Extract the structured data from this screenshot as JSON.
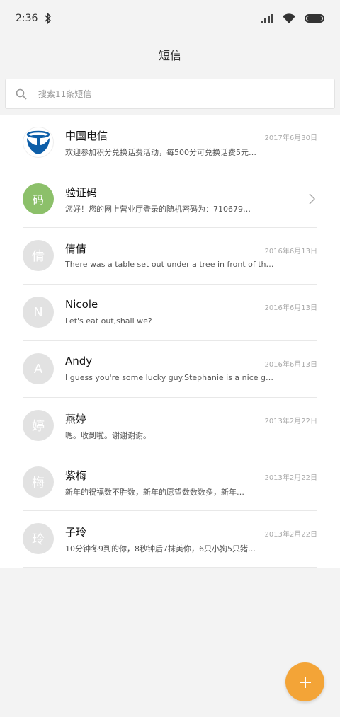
{
  "status_bar": {
    "time": "2:36",
    "icons": [
      "bluetooth-icon",
      "signal-icon",
      "wifi-icon",
      "battery-icon"
    ]
  },
  "header": {
    "title": "短信"
  },
  "search": {
    "placeholder": "搜索11条短信",
    "value": ""
  },
  "conversations": [
    {
      "name": "中国电信",
      "preview": "欢迎参加积分兑换话费活动，每500分可兑换话费5元…",
      "date": "2017年6月30日",
      "avatar_text": "",
      "avatar": "china-telecom-logo"
    },
    {
      "name": "验证码",
      "preview": "您好！您的网上营业厅登录的随机密码为：710679…",
      "date": "",
      "avatar_text": "码",
      "avatar": "green-code-avatar"
    },
    {
      "name": "倩倩",
      "preview": "There was a table set out under a tree in front of th…",
      "date": "2016年6月13日",
      "avatar_text": "倩",
      "avatar": "grey-avatar"
    },
    {
      "name": "Nicole",
      "preview": "Let's eat out,shall we?",
      "date": "2016年6月13日",
      "avatar_text": "N",
      "avatar": "grey-avatar"
    },
    {
      "name": "Andy",
      "preview": "I guess you're some lucky guy.Stephanie is a nice girl.",
      "date": "2016年6月13日",
      "avatar_text": "A",
      "avatar": "grey-avatar"
    },
    {
      "name": "燕婷",
      "preview": "嗯。收到啦。谢谢谢谢。",
      "date": "2013年2月22日",
      "avatar_text": "婷",
      "avatar": "grey-avatar"
    },
    {
      "name": "紫梅",
      "preview": "新年的祝福数不胜数，新年的愿望数数数多，新年…",
      "date": "2013年2月22日",
      "avatar_text": "梅",
      "avatar": "grey-avatar"
    },
    {
      "name": "子玲",
      "preview": "10分钟冬9到的你，8秒钟后7抹美你，6只小狗5只猪…",
      "date": "2013年2月22日",
      "avatar_text": "玲",
      "avatar": "grey-avatar"
    }
  ],
  "fab": {
    "icon": "plus-icon"
  },
  "colors": {
    "accent": "#f3a437",
    "avatar_grey": "#e2e2e2",
    "avatar_green": "#8cc06a",
    "telecom_blue": "#0d5ea8"
  }
}
